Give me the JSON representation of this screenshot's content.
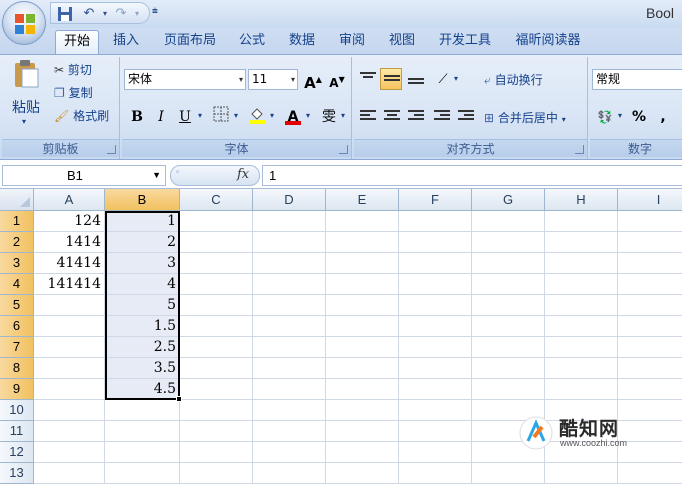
{
  "app": {
    "title": "Bool"
  },
  "qat": {
    "save_icon": "save-icon",
    "undo_icon": "undo-icon",
    "redo_icon": "redo-icon",
    "customize_glyph": "⩧"
  },
  "tabs": [
    "开始",
    "插入",
    "页面布局",
    "公式",
    "数据",
    "审阅",
    "视图",
    "开发工具",
    "福昕阅读器"
  ],
  "ribbon": {
    "clipboard": {
      "label": "剪贴板",
      "paste": "粘贴",
      "cut": "剪切",
      "copy": "复制",
      "format_painter": "格式刷"
    },
    "font": {
      "label": "字体",
      "name": "宋体",
      "size": "11",
      "bold": "B",
      "italic": "I",
      "underline": "U",
      "grow": "A",
      "shrink": "A",
      "font_color_glyph": "A",
      "phonetic": "雯"
    },
    "alignment": {
      "label": "对齐方式",
      "wrap_text": "自动换行",
      "merge_center": "合并后居中"
    },
    "number": {
      "label": "数字",
      "format": "常规",
      "percent": "%",
      "comma": ","
    }
  },
  "formula_bar": {
    "name_box": "B1",
    "fx": "fx",
    "value": "1"
  },
  "sheet": {
    "columns": [
      "A",
      "B",
      "C",
      "D",
      "E",
      "F",
      "G",
      "H",
      "I"
    ],
    "rows": [
      "1",
      "2",
      "3",
      "4",
      "5",
      "6",
      "7",
      "8",
      "9",
      "10",
      "11",
      "12",
      "13"
    ],
    "col_a": [
      "124",
      "1414",
      "41414",
      "141414",
      "",
      "",
      "",
      "",
      ""
    ],
    "col_b": [
      "1",
      "2",
      "3",
      "4",
      "5",
      "1.5",
      "2.5",
      "3.5",
      "4.5"
    ],
    "selected_column": "B",
    "selected_range": "B1:B9"
  },
  "watermark": {
    "name": "酷知网",
    "url": "www.coozhi.com"
  },
  "colors": {
    "accent": "#15428b",
    "selection_header": "#f1c15f",
    "selection_fill": "#e7ebf5"
  }
}
